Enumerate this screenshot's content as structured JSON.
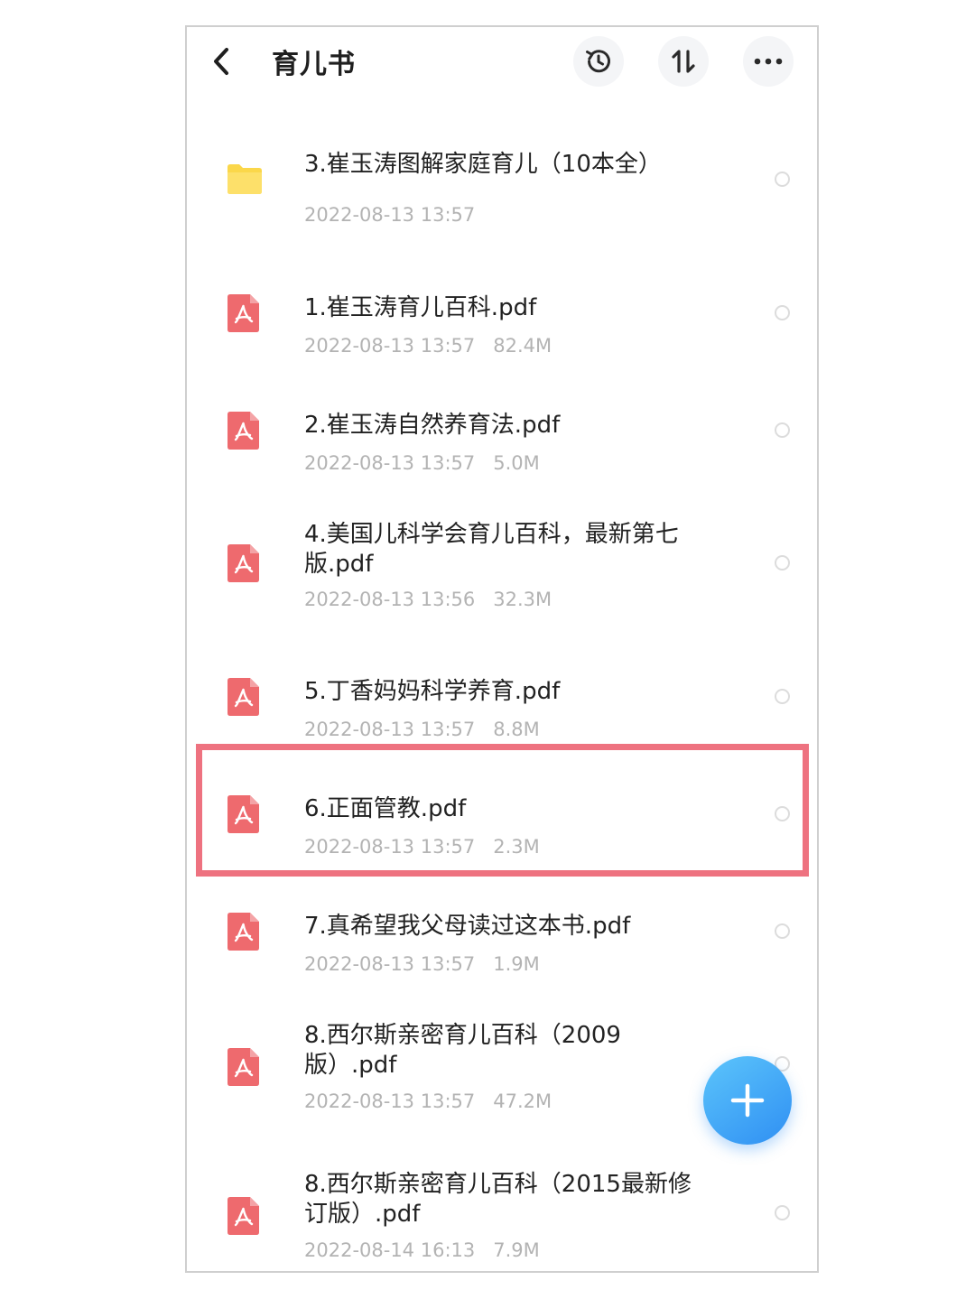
{
  "header": {
    "title": "育儿书",
    "back_icon": "chevron-left-icon",
    "actions": [
      {
        "name": "history-button",
        "icon": "history-icon"
      },
      {
        "name": "sort-button",
        "icon": "sort-icon"
      },
      {
        "name": "more-button",
        "icon": "more-horizontal-icon"
      }
    ]
  },
  "colors": {
    "folder": "#fbd74a",
    "pdf": "#ee6a6e",
    "highlight": "#ee7280",
    "fab": "#3d9ff6"
  },
  "files": [
    {
      "type": "folder",
      "name": "3.崔玉涛图解家庭育儿（10本全）",
      "date": "2022-08-13 13:57",
      "size": ""
    },
    {
      "type": "pdf",
      "name": "1.崔玉涛育儿百科.pdf",
      "date": "2022-08-13 13:57",
      "size": "82.4M"
    },
    {
      "type": "pdf",
      "name": "2.崔玉涛自然养育法.pdf",
      "date": "2022-08-13 13:57",
      "size": "5.0M"
    },
    {
      "type": "pdf",
      "name": "4.美国儿科学会育儿百科，最新第七版.pdf",
      "date": "2022-08-13 13:56",
      "size": "32.3M"
    },
    {
      "type": "pdf",
      "name": "5.丁香妈妈科学养育.pdf",
      "date": "2022-08-13 13:57",
      "size": "8.8M"
    },
    {
      "type": "pdf",
      "name": "6.正面管教.pdf",
      "date": "2022-08-13 13:57",
      "size": "2.3M",
      "highlighted": true
    },
    {
      "type": "pdf",
      "name": "7.真希望我父母读过这本书.pdf",
      "date": "2022-08-13 13:57",
      "size": "1.9M"
    },
    {
      "type": "pdf",
      "name": "8.西尔斯亲密育儿百科（2009版）.pdf",
      "date": "2022-08-13 13:57",
      "size": "47.2M"
    },
    {
      "type": "pdf",
      "name": "8.西尔斯亲密育儿百科（2015最新修订版）.pdf",
      "date": "2022-08-14 16:13",
      "size": "7.9M"
    }
  ],
  "fab": {
    "icon": "plus-icon"
  }
}
